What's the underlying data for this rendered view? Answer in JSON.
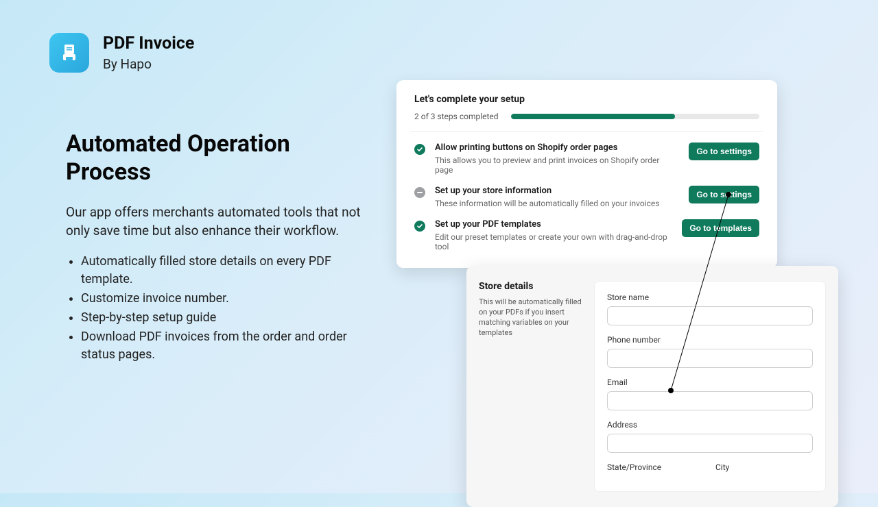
{
  "app": {
    "title": "PDF Invoice",
    "by": "By Hapo"
  },
  "heading": "Automated Operation Process",
  "description": "Our app offers merchants automated tools that not only save time but also enhance their workflow.",
  "bullets": [
    "Automatically filled store details on every PDF template.",
    "Customize invoice number.",
    "Step-by-step setup guide",
    "Download PDF invoices from the order and order status pages."
  ],
  "setup": {
    "title": "Let's complete your setup",
    "progress_text": "2 of 3 steps completed",
    "progress_percent": 66,
    "steps": [
      {
        "status": "done",
        "title": "Allow printing buttons on Shopify order pages",
        "sub": "This allows you to preview and print invoices on Shopify order page",
        "button": "Go to settings"
      },
      {
        "status": "pending",
        "title": "Set up your store information",
        "sub": "These information will be automatically filled on your invoices",
        "button": "Go to settings"
      },
      {
        "status": "done",
        "title": "Set up your PDF templates",
        "sub": "Edit our preset templates or create your own with drag-and-drop tool",
        "button": "Go to templates"
      }
    ]
  },
  "details": {
    "title": "Store details",
    "hint": "This will be automatically filled on your PDFs if you insert matching variables on your templates",
    "fields": {
      "store_name": "Store name",
      "phone": "Phone number",
      "email": "Email",
      "address": "Address",
      "state": "State/Province",
      "city": "City"
    }
  }
}
